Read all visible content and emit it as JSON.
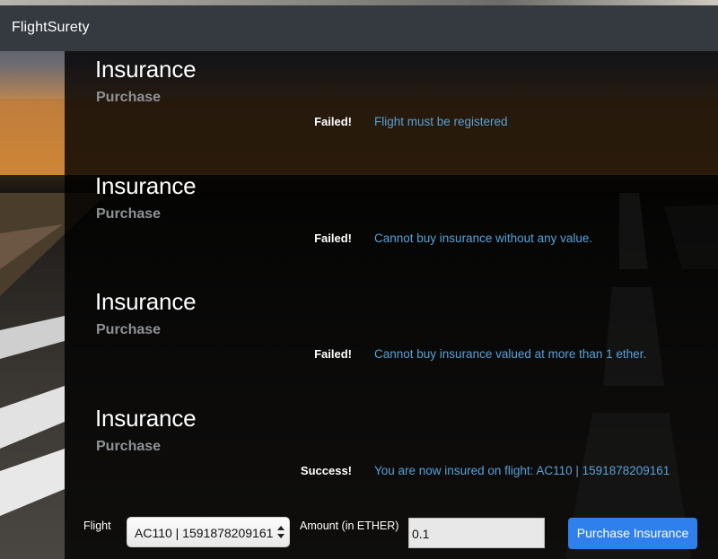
{
  "navbar": {
    "brand": "FlightSurety"
  },
  "sections": [
    {
      "title": "Insurance",
      "subtitle": "Purchase",
      "status": "Failed!",
      "message": "Flight must be registered"
    },
    {
      "title": "Insurance",
      "subtitle": "Purchase",
      "status": "Failed!",
      "message": "Cannot buy insurance without any value."
    },
    {
      "title": "Insurance",
      "subtitle": "Purchase",
      "status": "Failed!",
      "message": "Cannot buy insurance valued at more than 1 ether."
    },
    {
      "title": "Insurance",
      "subtitle": "Purchase",
      "status": "Success!",
      "message": "You are now insured on flight: AC110 | 1591878209161"
    }
  ],
  "form": {
    "flight_label": "Flight",
    "flight_selected": "AC110 | 1591878209161",
    "amount_label": "Amount (in ETHER)",
    "amount_value": "0.1",
    "purchase_button": "Purchase Insurance"
  },
  "colors": {
    "navbar": "#343a40",
    "message": "#5aa0d6",
    "button": "#2f80ec"
  },
  "icons": {
    "select_arrows": "chevron-up-down-icon"
  }
}
